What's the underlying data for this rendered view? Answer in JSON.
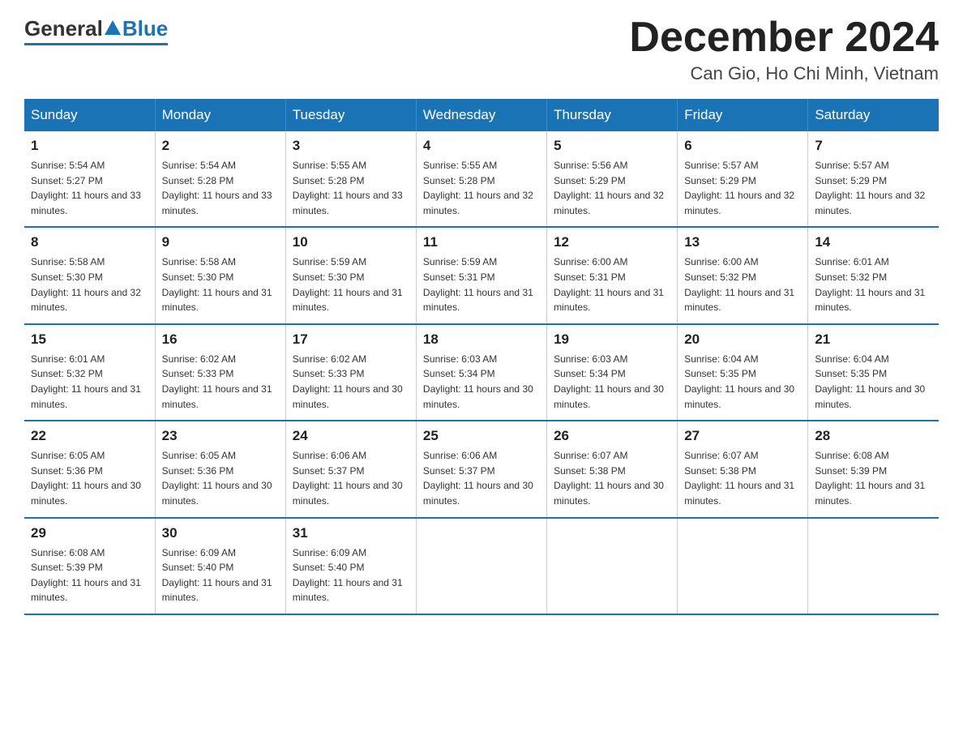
{
  "logo": {
    "general": "General",
    "blue": "Blue"
  },
  "title": {
    "month_year": "December 2024",
    "location": "Can Gio, Ho Chi Minh, Vietnam"
  },
  "days_of_week": [
    "Sunday",
    "Monday",
    "Tuesday",
    "Wednesday",
    "Thursday",
    "Friday",
    "Saturday"
  ],
  "weeks": [
    [
      {
        "num": "1",
        "sunrise": "5:54 AM",
        "sunset": "5:27 PM",
        "daylight": "11 hours and 33 minutes."
      },
      {
        "num": "2",
        "sunrise": "5:54 AM",
        "sunset": "5:28 PM",
        "daylight": "11 hours and 33 minutes."
      },
      {
        "num": "3",
        "sunrise": "5:55 AM",
        "sunset": "5:28 PM",
        "daylight": "11 hours and 33 minutes."
      },
      {
        "num": "4",
        "sunrise": "5:55 AM",
        "sunset": "5:28 PM",
        "daylight": "11 hours and 32 minutes."
      },
      {
        "num": "5",
        "sunrise": "5:56 AM",
        "sunset": "5:29 PM",
        "daylight": "11 hours and 32 minutes."
      },
      {
        "num": "6",
        "sunrise": "5:57 AM",
        "sunset": "5:29 PM",
        "daylight": "11 hours and 32 minutes."
      },
      {
        "num": "7",
        "sunrise": "5:57 AM",
        "sunset": "5:29 PM",
        "daylight": "11 hours and 32 minutes."
      }
    ],
    [
      {
        "num": "8",
        "sunrise": "5:58 AM",
        "sunset": "5:30 PM",
        "daylight": "11 hours and 32 minutes."
      },
      {
        "num": "9",
        "sunrise": "5:58 AM",
        "sunset": "5:30 PM",
        "daylight": "11 hours and 31 minutes."
      },
      {
        "num": "10",
        "sunrise": "5:59 AM",
        "sunset": "5:30 PM",
        "daylight": "11 hours and 31 minutes."
      },
      {
        "num": "11",
        "sunrise": "5:59 AM",
        "sunset": "5:31 PM",
        "daylight": "11 hours and 31 minutes."
      },
      {
        "num": "12",
        "sunrise": "6:00 AM",
        "sunset": "5:31 PM",
        "daylight": "11 hours and 31 minutes."
      },
      {
        "num": "13",
        "sunrise": "6:00 AM",
        "sunset": "5:32 PM",
        "daylight": "11 hours and 31 minutes."
      },
      {
        "num": "14",
        "sunrise": "6:01 AM",
        "sunset": "5:32 PM",
        "daylight": "11 hours and 31 minutes."
      }
    ],
    [
      {
        "num": "15",
        "sunrise": "6:01 AM",
        "sunset": "5:32 PM",
        "daylight": "11 hours and 31 minutes."
      },
      {
        "num": "16",
        "sunrise": "6:02 AM",
        "sunset": "5:33 PM",
        "daylight": "11 hours and 31 minutes."
      },
      {
        "num": "17",
        "sunrise": "6:02 AM",
        "sunset": "5:33 PM",
        "daylight": "11 hours and 30 minutes."
      },
      {
        "num": "18",
        "sunrise": "6:03 AM",
        "sunset": "5:34 PM",
        "daylight": "11 hours and 30 minutes."
      },
      {
        "num": "19",
        "sunrise": "6:03 AM",
        "sunset": "5:34 PM",
        "daylight": "11 hours and 30 minutes."
      },
      {
        "num": "20",
        "sunrise": "6:04 AM",
        "sunset": "5:35 PM",
        "daylight": "11 hours and 30 minutes."
      },
      {
        "num": "21",
        "sunrise": "6:04 AM",
        "sunset": "5:35 PM",
        "daylight": "11 hours and 30 minutes."
      }
    ],
    [
      {
        "num": "22",
        "sunrise": "6:05 AM",
        "sunset": "5:36 PM",
        "daylight": "11 hours and 30 minutes."
      },
      {
        "num": "23",
        "sunrise": "6:05 AM",
        "sunset": "5:36 PM",
        "daylight": "11 hours and 30 minutes."
      },
      {
        "num": "24",
        "sunrise": "6:06 AM",
        "sunset": "5:37 PM",
        "daylight": "11 hours and 30 minutes."
      },
      {
        "num": "25",
        "sunrise": "6:06 AM",
        "sunset": "5:37 PM",
        "daylight": "11 hours and 30 minutes."
      },
      {
        "num": "26",
        "sunrise": "6:07 AM",
        "sunset": "5:38 PM",
        "daylight": "11 hours and 30 minutes."
      },
      {
        "num": "27",
        "sunrise": "6:07 AM",
        "sunset": "5:38 PM",
        "daylight": "11 hours and 31 minutes."
      },
      {
        "num": "28",
        "sunrise": "6:08 AM",
        "sunset": "5:39 PM",
        "daylight": "11 hours and 31 minutes."
      }
    ],
    [
      {
        "num": "29",
        "sunrise": "6:08 AM",
        "sunset": "5:39 PM",
        "daylight": "11 hours and 31 minutes."
      },
      {
        "num": "30",
        "sunrise": "6:09 AM",
        "sunset": "5:40 PM",
        "daylight": "11 hours and 31 minutes."
      },
      {
        "num": "31",
        "sunrise": "6:09 AM",
        "sunset": "5:40 PM",
        "daylight": "11 hours and 31 minutes."
      },
      null,
      null,
      null,
      null
    ]
  ]
}
